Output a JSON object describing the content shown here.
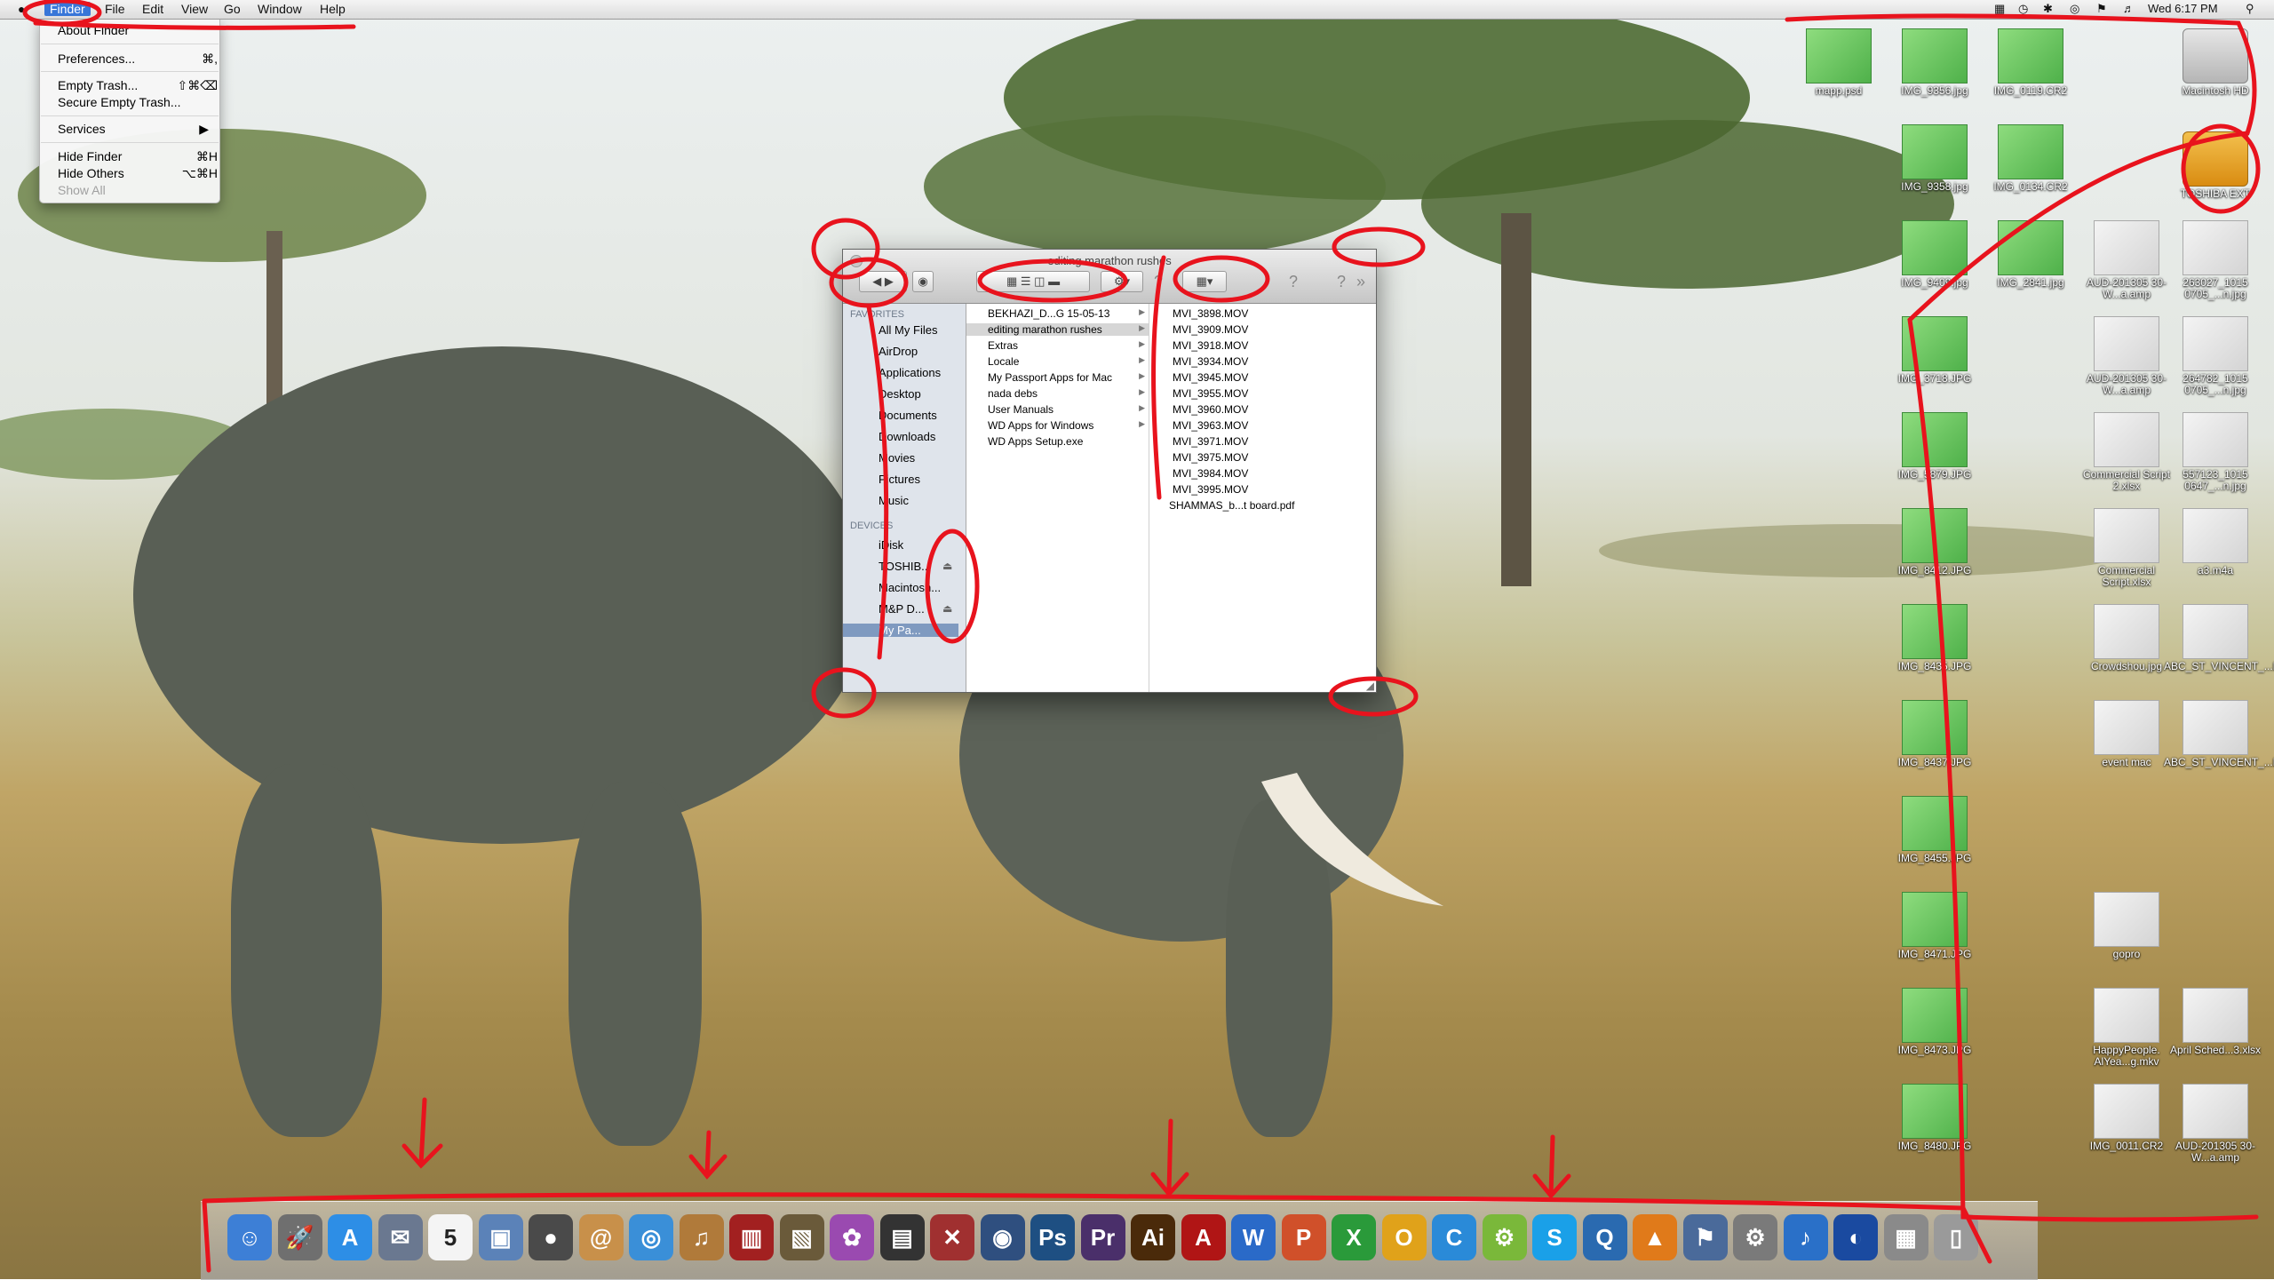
{
  "menubar": {
    "apple": "",
    "app": "Finder",
    "file": "File",
    "edit": "Edit",
    "view": "View",
    "go": "Go",
    "window": "Window",
    "help": "Help",
    "clock": "Wed 6:17 PM"
  },
  "finder_menu": {
    "about": "About Finder",
    "preferences": "Preferences...",
    "preferences_sc": "⌘,",
    "empty_trash": "Empty Trash...",
    "empty_trash_sc": "⇧⌘⌫",
    "secure_empty": "Secure Empty Trash...",
    "services": "Services",
    "hide_finder": "Hide Finder",
    "hide_finder_sc": "⌘H",
    "hide_others": "Hide Others",
    "hide_others_sc": "⌥⌘H",
    "show_all": "Show All"
  },
  "window": {
    "title": "editing marathon rushes",
    "help_glyph": "?",
    "more_glyph": "»",
    "sidebar": {
      "favorites_header": "FAVORITES",
      "favorites": [
        "All My Files",
        "AirDrop",
        "Applications",
        "Desktop",
        "Documents",
        "Downloads",
        "Movies",
        "Pictures",
        "Music"
      ],
      "devices_header": "DEVICES",
      "devices": [
        "iDisk",
        "TOSHIB...",
        "Macintosh...",
        "M&P D...",
        "My Pa..."
      ]
    },
    "column1": [
      "BEKHAZI_D...G 15-05-13",
      "editing marathon rushes",
      "Extras",
      "Locale",
      "My Passport Apps for Mac",
      "nada debs",
      "User Manuals",
      "WD Apps for Windows",
      "WD Apps Setup.exe"
    ],
    "column2": [
      "MVI_3898.MOV",
      "MVI_3909.MOV",
      "MVI_3918.MOV",
      "MVI_3934.MOV",
      "MVI_3945.MOV",
      "MVI_3955.MOV",
      "MVI_3960.MOV",
      "MVI_3963.MOV",
      "MVI_3971.MOV",
      "MVI_3975.MOV",
      "MVI_3984.MOV",
      "MVI_3995.MOV",
      "SHAMMAS_b...t board.pdf"
    ]
  },
  "desktop_icons": [
    {
      "label": "mapp.psd",
      "kind": "green"
    },
    {
      "label": "IMG_9356.jpg",
      "kind": "green"
    },
    {
      "label": "IMG_0119.CR2",
      "kind": "green"
    },
    {
      "label": "Macintosh HD",
      "kind": "hd"
    },
    {
      "label": "IMG_9358.jpg",
      "kind": "green"
    },
    {
      "label": "IMG_0134.CR2",
      "kind": "green"
    },
    {
      "label": "TOSHIBA EXT",
      "kind": "drive"
    },
    {
      "label": "IMG_9409.jpg",
      "kind": "green"
    },
    {
      "label": "IMG_2841.jpg",
      "kind": "green"
    },
    {
      "label": "AUD-201305 30-W...a.amp",
      "kind": "doc"
    },
    {
      "label": "263027_1015 0705_...n.jpg",
      "kind": "doc"
    },
    {
      "label": "IMG_3718.JPG",
      "kind": "green"
    },
    {
      "label": "AUD-201305 30-W...a.amp",
      "kind": "doc"
    },
    {
      "label": "264782_1015 0705_...n.jpg",
      "kind": "doc"
    },
    {
      "label": "IMG_5879.JPG",
      "kind": "green"
    },
    {
      "label": "Commercial Script 2.xlsx",
      "kind": "doc"
    },
    {
      "label": "557123_1015 0647_...n.jpg",
      "kind": "doc"
    },
    {
      "label": "IMG_8412.JPG",
      "kind": "green"
    },
    {
      "label": "Commercial Script.xlsx",
      "kind": "doc"
    },
    {
      "label": "a3.m4a",
      "kind": "doc"
    },
    {
      "label": "IMG_8435.JPG",
      "kind": "green"
    },
    {
      "label": "Crowdshou.jpg",
      "kind": "doc"
    },
    {
      "label": "ABC_ST_VINCENT_...E.mp4",
      "kind": "doc"
    },
    {
      "label": "IMG_8437.JPG",
      "kind": "green"
    },
    {
      "label": "event mac",
      "kind": "doc"
    },
    {
      "label": "ABC_ST_VINCENT_...E.mp4",
      "kind": "doc"
    },
    {
      "label": "IMG_8455.JPG",
      "kind": "green"
    },
    {
      "label": "IMG_8471.JPG",
      "kind": "green"
    },
    {
      "label": "gopro",
      "kind": "doc"
    },
    {
      "label": "IMG_8473.JPG",
      "kind": "green"
    },
    {
      "label": "HappyPeople. AlYea...g.mkv",
      "kind": "doc"
    },
    {
      "label": "April Sched...3.xlsx",
      "kind": "doc"
    },
    {
      "label": "IMG_8480.JPG",
      "kind": "green"
    },
    {
      "label": "IMG_0011.CR2",
      "kind": "doc"
    },
    {
      "label": "AUD-201305 30-W...a.amp",
      "kind": "doc"
    }
  ],
  "dock": [
    {
      "name": "finder",
      "glyph": "☺",
      "color": "#3d7fd6"
    },
    {
      "name": "launchpad",
      "glyph": "🚀",
      "color": "#6f6f6f"
    },
    {
      "name": "app-store",
      "glyph": "A",
      "color": "#2d8ee6"
    },
    {
      "name": "mail",
      "glyph": "✉",
      "color": "#6a7890"
    },
    {
      "name": "calendar",
      "glyph": "5",
      "color": "#f4f4f4"
    },
    {
      "name": "preview",
      "glyph": "▣",
      "color": "#5b82b8"
    },
    {
      "name": "facetime",
      "glyph": "●",
      "color": "#4a4a4a"
    },
    {
      "name": "contacts",
      "glyph": "@",
      "color": "#c8904a"
    },
    {
      "name": "safari",
      "glyph": "◎",
      "color": "#3a8fd8"
    },
    {
      "name": "garageband",
      "glyph": "♫",
      "color": "#b07a3a"
    },
    {
      "name": "photo-booth",
      "glyph": "▥",
      "color": "#a22020"
    },
    {
      "name": "iphoto",
      "glyph": "▧",
      "color": "#6a5a3a"
    },
    {
      "name": "color-picker",
      "glyph": "✿",
      "color": "#9a4ab0"
    },
    {
      "name": "final-cut",
      "glyph": "▤",
      "color": "#333333"
    },
    {
      "name": "crossover",
      "glyph": "✕",
      "color": "#a03030"
    },
    {
      "name": "quicktime",
      "glyph": "◉",
      "color": "#2f4f7f"
    },
    {
      "name": "photoshop",
      "glyph": "Ps",
      "color": "#1e4f82"
    },
    {
      "name": "premiere",
      "glyph": "Pr",
      "color": "#4a2f6a"
    },
    {
      "name": "illustrator",
      "glyph": "Ai",
      "color": "#4a2a0a"
    },
    {
      "name": "acrobat",
      "glyph": "A",
      "color": "#b01515"
    },
    {
      "name": "word",
      "glyph": "W",
      "color": "#2a6ac8"
    },
    {
      "name": "powerpoint",
      "glyph": "P",
      "color": "#d0502a"
    },
    {
      "name": "excel",
      "glyph": "X",
      "color": "#2a9a3a"
    },
    {
      "name": "outlook",
      "glyph": "O",
      "color": "#e0a21a"
    },
    {
      "name": "communicator",
      "glyph": "C",
      "color": "#2a8ad8"
    },
    {
      "name": "android",
      "glyph": "⚙",
      "color": "#7ab83a"
    },
    {
      "name": "skype",
      "glyph": "S",
      "color": "#1aa0e8"
    },
    {
      "name": "search",
      "glyph": "Q",
      "color": "#2a6ab0"
    },
    {
      "name": "vlc",
      "glyph": "▲",
      "color": "#e07a1a"
    },
    {
      "name": "automator",
      "glyph": "⚑",
      "color": "#4a6a9a"
    },
    {
      "name": "system-preferences",
      "glyph": "⚙",
      "color": "#7a7a7a"
    },
    {
      "name": "itunes",
      "glyph": "♪",
      "color": "#2a70c8"
    },
    {
      "name": "google-earth",
      "glyph": "◐",
      "color": "#1a4aa0"
    },
    {
      "name": "downloads-stack",
      "glyph": "▦",
      "color": "#8a8a8a"
    },
    {
      "name": "trash",
      "glyph": "▯",
      "color": "#9a9a9a"
    }
  ],
  "colors": {
    "annotation": "#e8131d",
    "selection": "#3876d8",
    "sidebar": "#dfe4eb"
  }
}
